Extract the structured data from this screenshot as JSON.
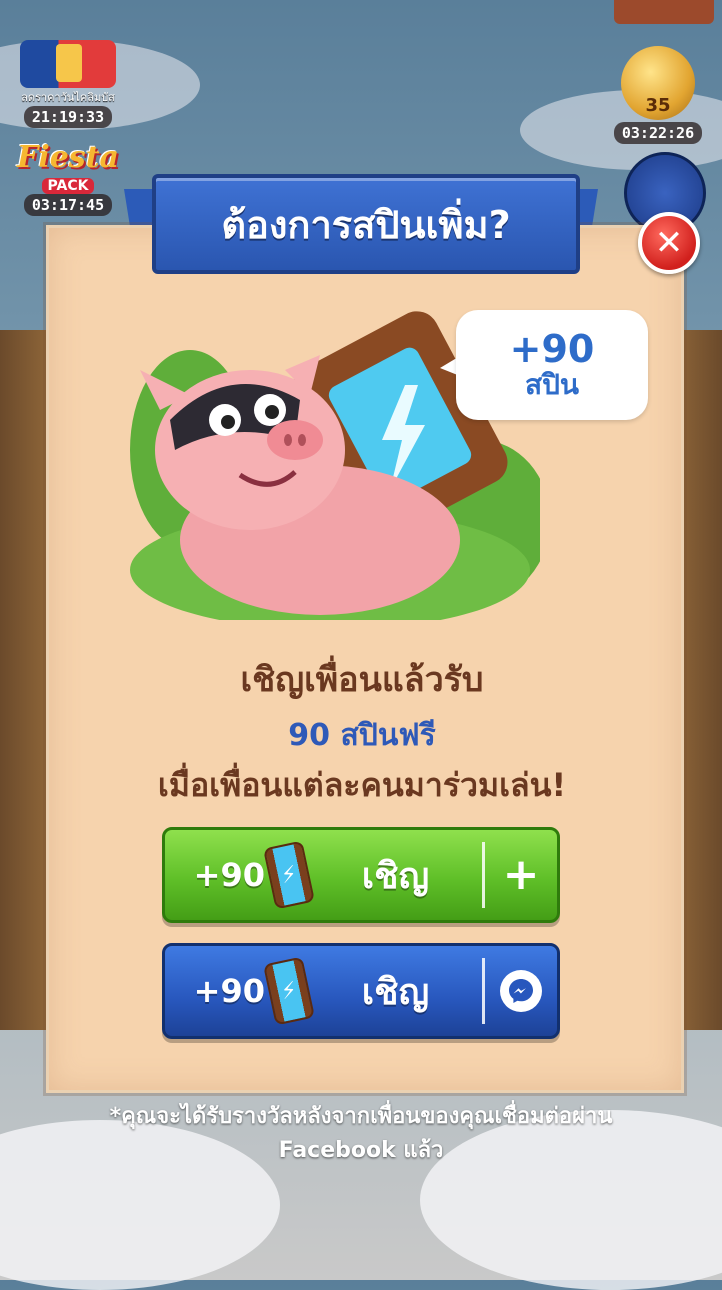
{
  "hud": {
    "left_event_label": "ลดราคาวันไคลิมบัส",
    "left_event_timer": "21:19:33",
    "fiesta_title": "Fiesta",
    "fiesta_sub": "PACK",
    "fiesta_timer": "03:17:45",
    "right_level": "35",
    "right_timer": "03:22:26"
  },
  "dialog": {
    "title": "ต้องการสปินเพิ่ม?",
    "close_icon": "close-icon",
    "bubble_amount": "+90",
    "bubble_unit": "สปิน",
    "message_line1": "เชิญเพื่อนแล้วรับ",
    "message_line2": "90 สปินฟรี",
    "message_line3": "เมื่อเพื่อนแต่ละคนมาร่วมเล่น!",
    "buttons": [
      {
        "bonus": "+90",
        "label": "เชิญ",
        "side_icon": "plus-icon",
        "color": "#5fbf28"
      },
      {
        "bonus": "+90",
        "label": "เชิญ",
        "side_icon": "messenger-icon",
        "color": "#2857bd"
      }
    ]
  },
  "footnote": {
    "line1": "*คุณจะได้รับรางวัลหลังจากเพื่อนของคุณเชื่อมต่อผ่าน",
    "line2": "Facebook แล้ว"
  }
}
